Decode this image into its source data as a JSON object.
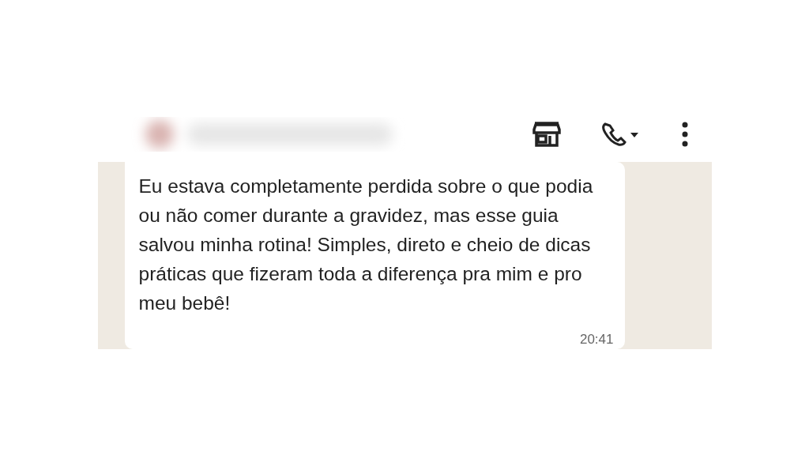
{
  "header": {
    "actions": [
      {
        "kind": "store"
      },
      {
        "kind": "call"
      },
      {
        "kind": "menu"
      }
    ]
  },
  "messages": [
    {
      "text": "Eu estava completamente perdida sobre o que podia ou não comer durante a gravidez, mas esse guia salvou minha rotina! Simples, direto e cheio de dicas práticas que fizeram toda a diferença pra mim e pro meu bebê!",
      "time": "20:41"
    }
  ]
}
